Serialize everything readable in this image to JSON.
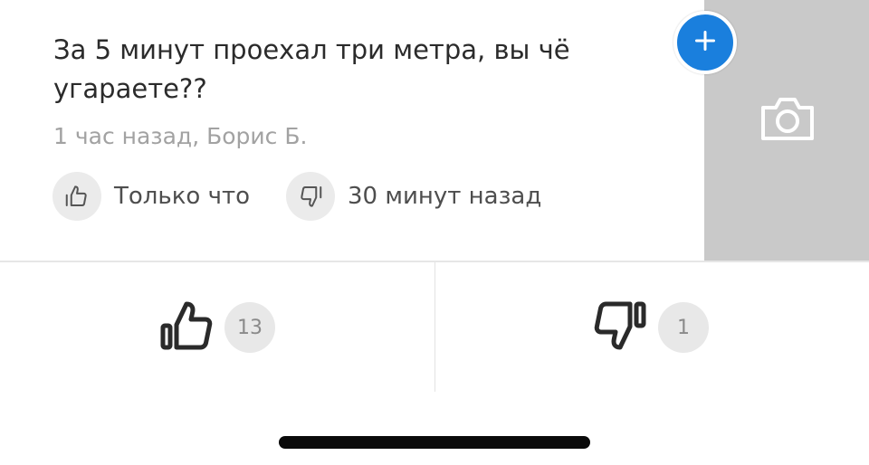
{
  "comment": {
    "text": "За 5 минут проехал три метра, вы чё угараете??",
    "meta": "1 час назад, Борис Б.",
    "like_reaction": {
      "icon": "thumb-up-icon",
      "label": "Только что"
    },
    "dislike_reaction": {
      "icon": "thumb-down-icon",
      "label": "30 минут назад"
    }
  },
  "photo_panel": {
    "icon": "camera-icon",
    "background": "#c9c9c9"
  },
  "add_button": {
    "icon": "plus-icon",
    "color": "#1a7fdd"
  },
  "votes": {
    "likes": {
      "icon": "thumb-up-icon",
      "count": "13"
    },
    "dislikes": {
      "icon": "thumb-down-icon",
      "count": "1"
    }
  }
}
